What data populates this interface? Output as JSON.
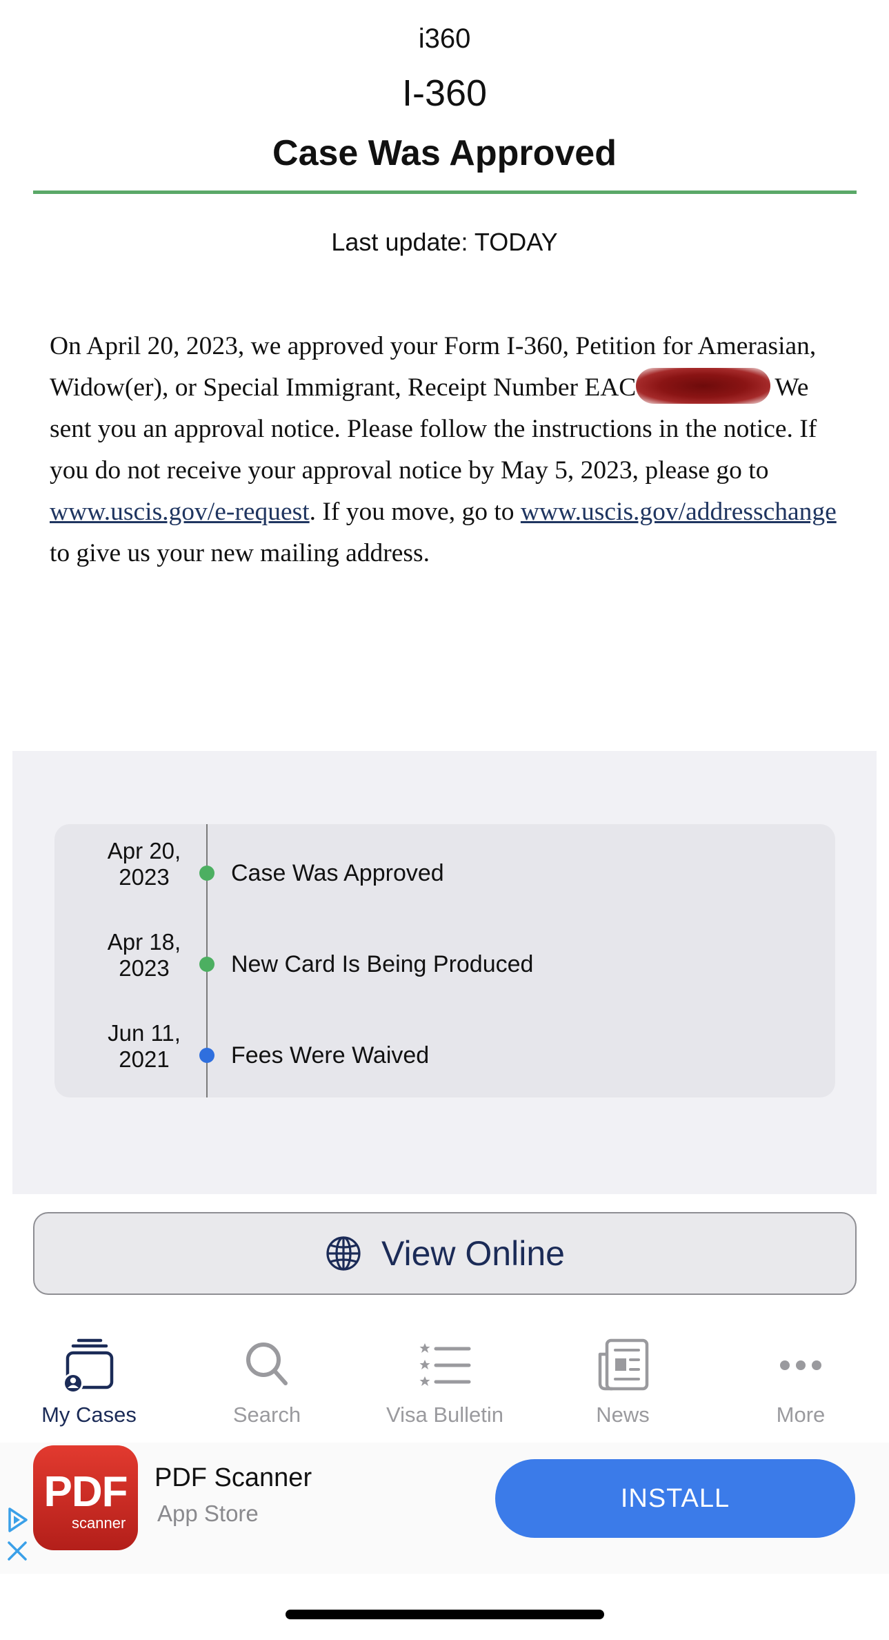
{
  "header": {
    "form_code": "i360",
    "form_name": "I-360",
    "status": "Case Was Approved",
    "last_update": "Last update: TODAY"
  },
  "body": {
    "part1": "On April 20, 2023, we approved your Form I-360, Petition for Amerasian, Widow(er), or Special Immigrant, Receipt Number EAC",
    "part2": "We sent you an approval notice. Please follow the instructions in the notice. If you do not receive your approval notice by May 5, 2023, please go to ",
    "link1": "www.uscis.gov/e-request",
    "part3": ". If you move, go to ",
    "link2": "www.uscis.gov/addresschange",
    "part4": " to give us your new mailing address."
  },
  "timeline": [
    {
      "date_line1": "Apr 20,",
      "date_line2": "2023",
      "event": "Case Was Approved",
      "dot_color": "#4caf61"
    },
    {
      "date_line1": "Apr 18,",
      "date_line2": "2023",
      "event": "New Card Is Being Produced",
      "dot_color": "#4caf61"
    },
    {
      "date_line1": "Jun 11,",
      "date_line2": "2021",
      "event": "Fees Were Waived",
      "dot_color": "#2f6fde"
    }
  ],
  "view_online": {
    "label": "View Online",
    "icon": "globe-icon"
  },
  "tabs": [
    {
      "label": "My Cases",
      "icon": "my-cases-icon",
      "active": true
    },
    {
      "label": "Search",
      "icon": "search-icon",
      "active": false
    },
    {
      "label": "Visa Bulletin",
      "icon": "visa-bulletin-icon",
      "active": false
    },
    {
      "label": "News",
      "icon": "news-icon",
      "active": false
    },
    {
      "label": "More",
      "icon": "more-icon",
      "active": false
    }
  ],
  "ad": {
    "icon_text": "PDF",
    "icon_subtext": "scanner",
    "title": "PDF Scanner",
    "store": "App Store",
    "install_label": "INSTALL"
  },
  "colors": {
    "accent_green": "#5aa868",
    "navy": "#1b2b57",
    "install_blue": "#3b7be9"
  }
}
